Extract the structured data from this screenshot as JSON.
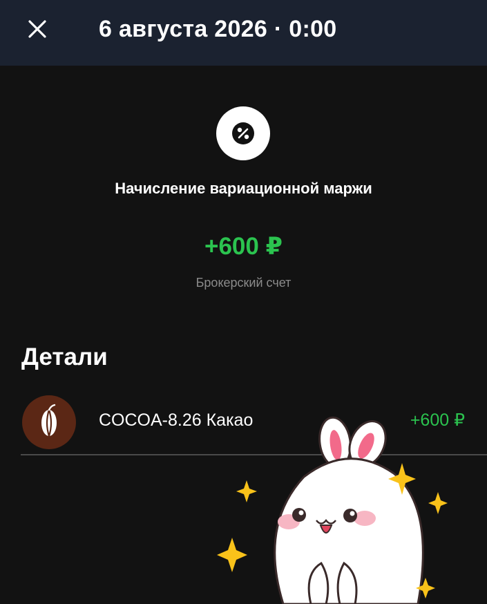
{
  "header": {
    "close_icon": "close-icon",
    "title": "6 августа 2026 · 0:00"
  },
  "operation": {
    "icon": "percent-icon",
    "title": "Начисление вариационной маржи",
    "amount": "+600 ₽",
    "account": "Брокерский счет"
  },
  "details": {
    "title": "Детали",
    "items": [
      {
        "icon": "cocoa-bean-icon",
        "label": "COCOA-8.26 Какао",
        "amount": "+600 ₽"
      }
    ]
  },
  "colors": {
    "background": "#121212",
    "topbar": "#1b2230",
    "positive": "#2bc34f",
    "secondary_text": "#8b8b8b",
    "cocoa_avatar": "#5b2715"
  },
  "overlay": {
    "icon": "bunny-sticker-icon"
  }
}
